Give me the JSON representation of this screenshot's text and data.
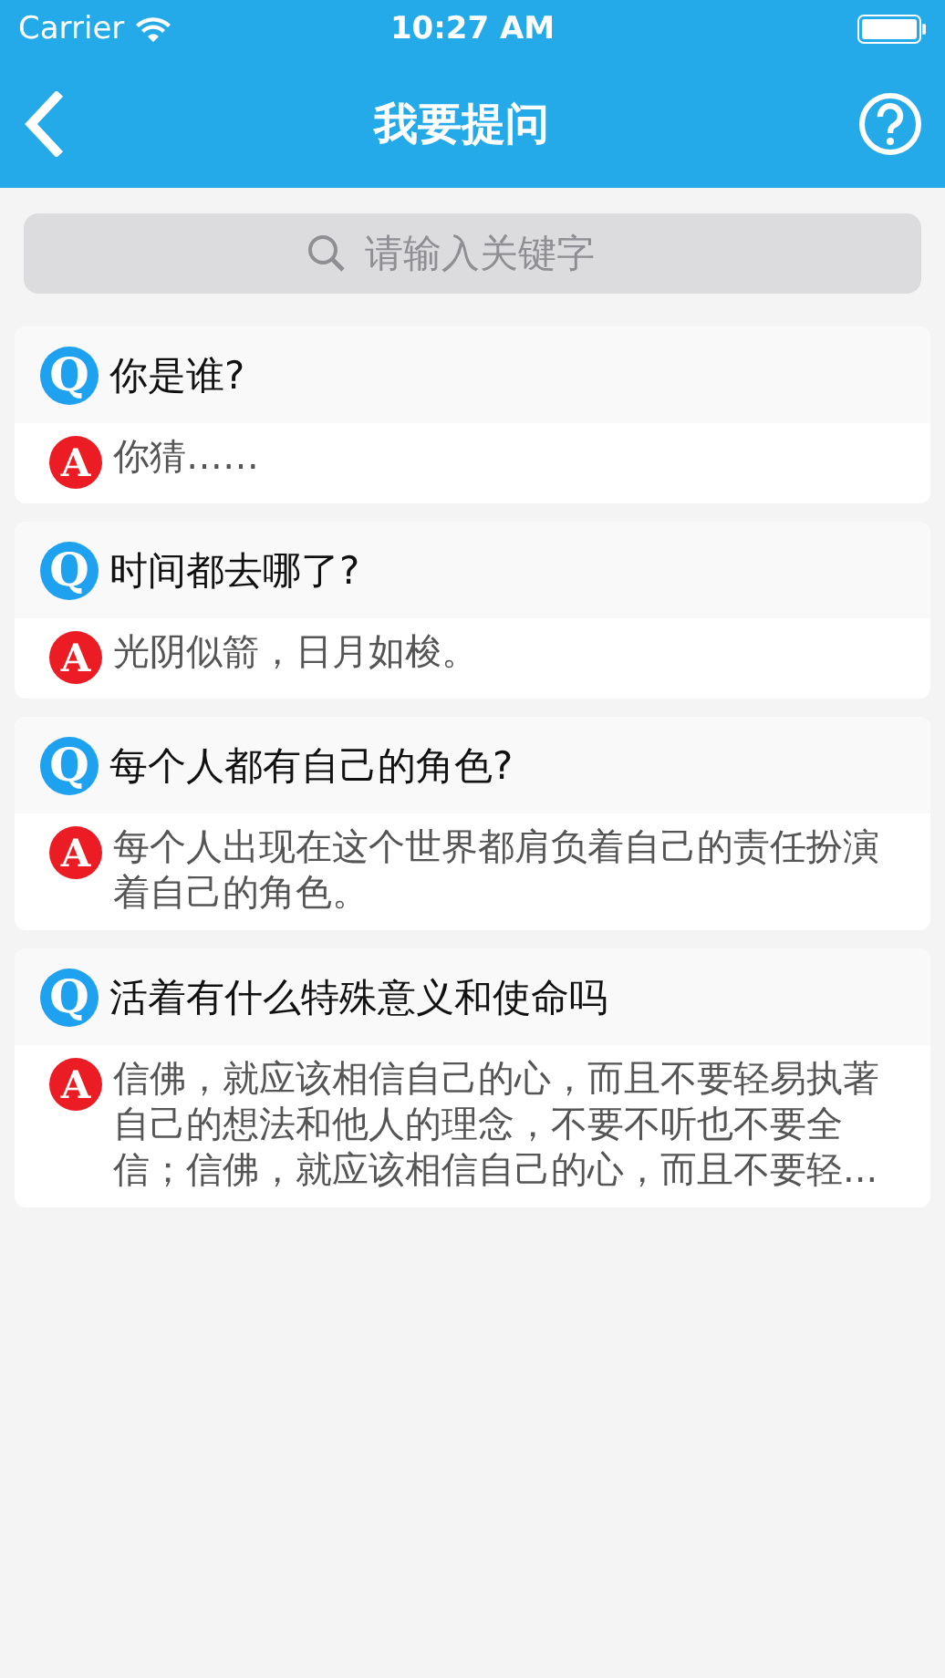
{
  "status_bar": {
    "carrier": "Carrier",
    "time": "10:27 AM"
  },
  "nav_bar": {
    "title": "我要提问"
  },
  "search": {
    "placeholder": "请输入关键字"
  },
  "qa_items": [
    {
      "question_badge": "Q",
      "question": "你是谁?",
      "answer_badge": "A",
      "answer": "你猜……"
    },
    {
      "question_badge": "Q",
      "question": "时间都去哪了?",
      "answer_badge": "A",
      "answer": "光阴似箭，日月如梭。"
    },
    {
      "question_badge": "Q",
      "question": "每个人都有自己的角色?",
      "answer_badge": "A",
      "answer": "每个人出现在这个世界都肩负着自己的责任扮演着自己的角色。"
    },
    {
      "question_badge": "Q",
      "question": "活着有什么特殊意义和使命吗",
      "answer_badge": "A",
      "answer": "信佛，就应该相信自己的心，而且不要轻易执著自己的想法和他人的理念，不要不听也不要全信；信佛，就应该相信自己的心，而且不要轻..."
    }
  ]
}
